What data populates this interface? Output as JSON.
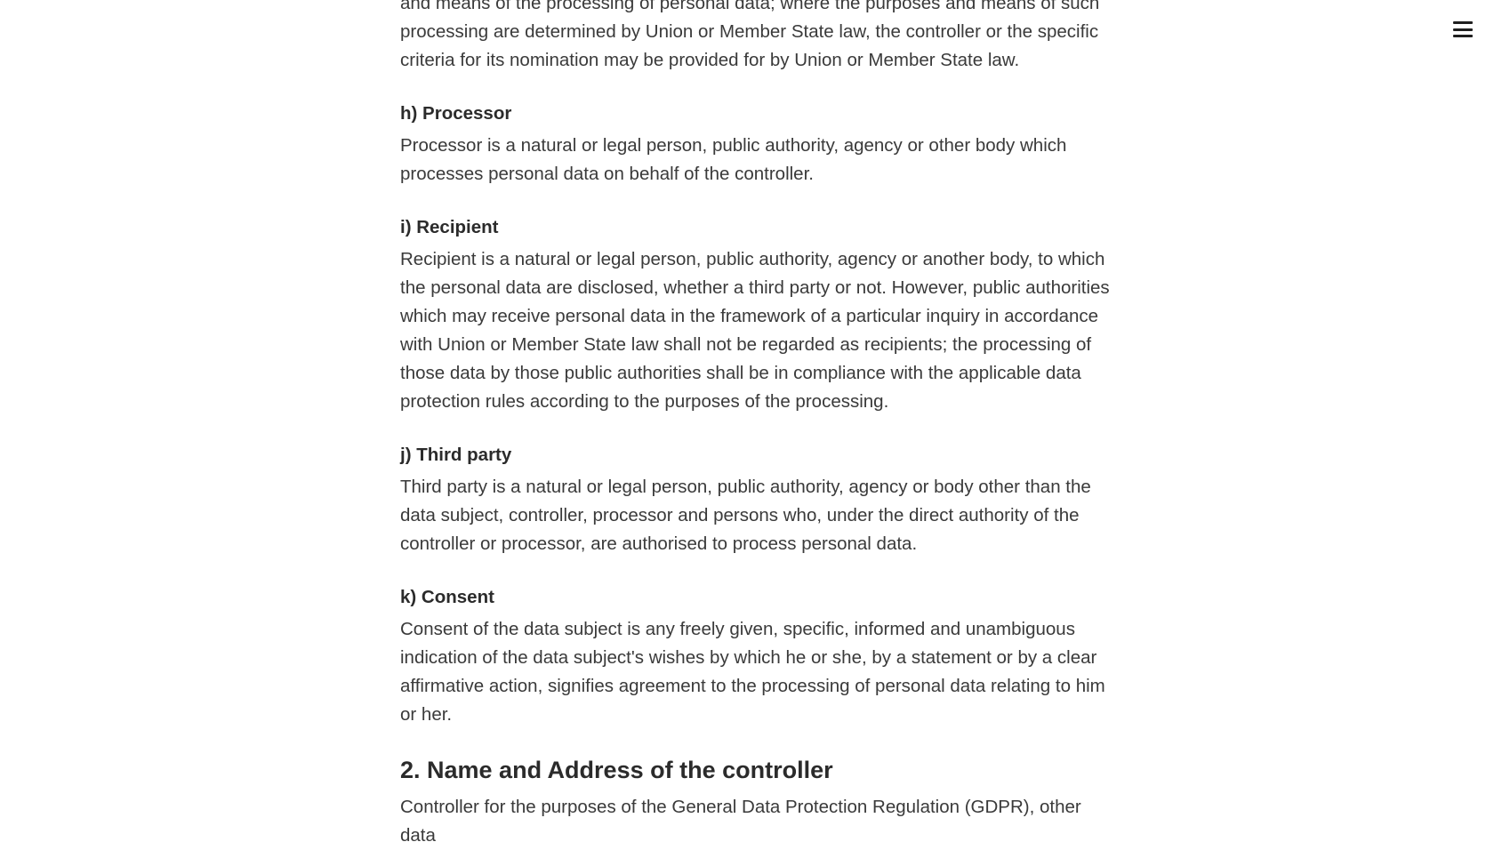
{
  "intro": {
    "text": "and means of the processing of personal data; where the purposes and means of such processing are determined by Union or Member State law, the controller or the specific criteria for its nomination may be provided for by Union or Member State law."
  },
  "definitions": [
    {
      "heading": "h) Processor",
      "text": "Processor is a natural or legal person, public authority, agency or other body which processes personal data on behalf of the controller."
    },
    {
      "heading": "i) Recipient",
      "text": "Recipient is a natural or legal person, public authority, agency or another body, to which the personal data are disclosed, whether a third party or not. However, public authorities which may receive personal data in the framework of a particular inquiry in accordance with Union or Member State law shall not be regarded as recipients; the processing of those data by those public authorities shall be in compliance with the applicable data protection rules according to the purposes of the processing."
    },
    {
      "heading": "j) Third party",
      "text": "Third party is a natural or legal person, public authority, agency or body other than the data subject, controller, processor and persons who, under the direct authority of the controller or processor, are authorised to process personal data."
    },
    {
      "heading": "k) Consent",
      "text": "Consent of the data subject is any freely given, specific, informed and unambiguous indication of the data subject's wishes by which he or she, by a statement or by a clear affirmative action, signifies agreement to the processing of personal data relating to him or her."
    }
  ],
  "section2": {
    "heading": "2. Name and Address of the controller",
    "text": "Controller for the purposes of the General Data Protection Regulation (GDPR), other data"
  },
  "menu": {
    "icon": "hamburger-menu-icon"
  }
}
